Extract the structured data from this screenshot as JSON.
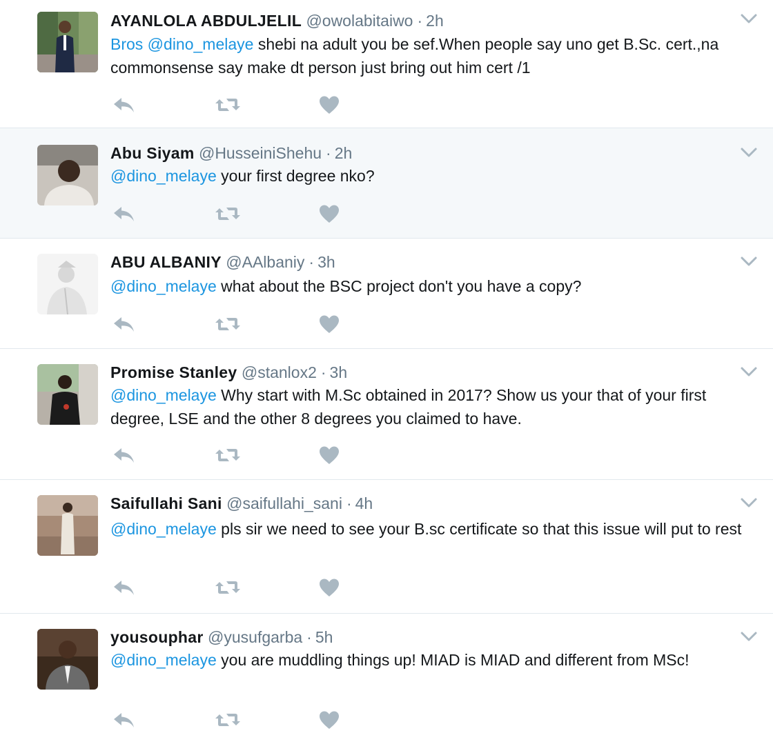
{
  "tweets": [
    {
      "name": "AYANLOLA ABDULJELIL",
      "handle": "@owolabitaiwo",
      "time": "2h",
      "mention": "Bros @dino_melaye",
      "text": " shebi na adult you be sef.When people say uno get B.Sc. cert.,na commonsense say make dt person just bring out him cert /1"
    },
    {
      "name": "Abu Siyam",
      "handle": "@HusseiniShehu",
      "time": "2h",
      "mention": "@dino_melaye",
      "text": " your first degree nko?"
    },
    {
      "name": "ABU ALBANIY",
      "handle": "@AAlbaniy",
      "time": "3h",
      "mention": "@dino_melaye",
      "text": " what about the BSC project don't you have a copy?"
    },
    {
      "name": "Promise Stanley",
      "handle": "@stanlox2",
      "time": "3h",
      "mention": "@dino_melaye",
      "text": " Why start with M.Sc obtained in 2017? Show us your that of your first degree, LSE and the other 8 degrees you claimed to have."
    },
    {
      "name": "Saifullahi Sani",
      "handle": "@saifullahi_sani",
      "time": "4h",
      "mention": "@dino_melaye",
      "text": " pls sir we need to see your B.sc certificate so that this issue will put to rest"
    },
    {
      "name": "yousouphar",
      "handle": "@yusufgarba",
      "time": "5h",
      "mention": "@dino_melaye",
      "text": " you are muddling things up! MIAD is MIAD and different from MSc!"
    }
  ],
  "separator": "·",
  "icons": {
    "reply": "reply-icon",
    "retweet": "retweet-icon",
    "like": "heart-icon",
    "more": "chevron-down-icon"
  },
  "colors": {
    "mention": "#1b95e0",
    "muted": "#657786",
    "icon": "#aab8c2",
    "highlight_bg": "#f5f8fa",
    "divider": "#e1e8ed"
  }
}
